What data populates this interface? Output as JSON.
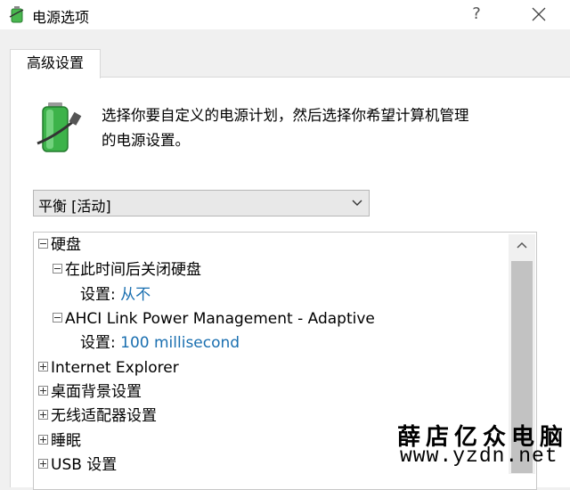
{
  "window": {
    "title": "电源选项",
    "help_label": "?",
    "title_icon": "power-options-icon",
    "close_icon": "close-icon"
  },
  "tabs": [
    {
      "label": "高级设置",
      "selected": true
    }
  ],
  "header": {
    "icon": "battery-plug-icon",
    "description_line1": "选择你要自定义的电源计划，然后选择你希望计算机管理",
    "description_line2": "的电源设置。"
  },
  "plan_select": {
    "value": "平衡 [活动]"
  },
  "tree": {
    "items": [
      {
        "label": "硬盘",
        "expanded": true
      },
      {
        "label": "在此时间后关闭硬盘",
        "expanded": true
      },
      {
        "label": "设置:",
        "value": "从不"
      },
      {
        "label": "AHCI Link Power Management - Adaptive",
        "expanded": true
      },
      {
        "label": "设置:",
        "value": "100 millisecond"
      },
      {
        "label": "Internet Explorer",
        "expanded": false
      },
      {
        "label": "桌面背景设置",
        "expanded": false
      },
      {
        "label": "无线适配器设置",
        "expanded": false
      },
      {
        "label": "睡眠",
        "expanded": false
      },
      {
        "label": "USB 设置",
        "expanded": false
      }
    ]
  },
  "watermark": {
    "line1": "薛店亿众电脑",
    "line2": "www.yzdn.net"
  },
  "colors": {
    "value_text": "#1a6fb0",
    "battery_green": "#3db34a",
    "window_bg": "#f0f0f0"
  }
}
